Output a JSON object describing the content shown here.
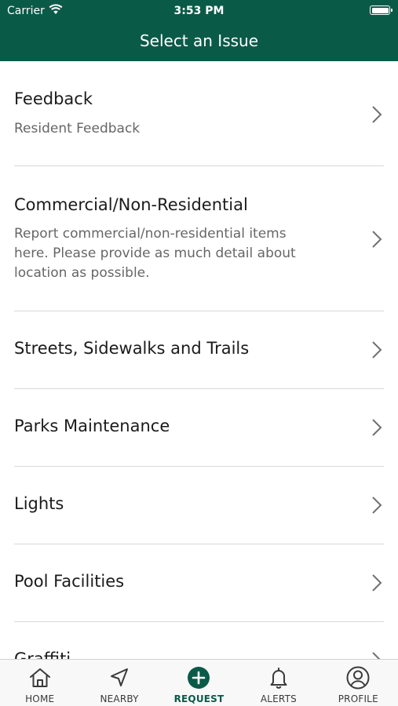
{
  "status": {
    "carrier": "Carrier",
    "time": "3:53 PM"
  },
  "nav": {
    "title": "Select an Issue"
  },
  "issues": [
    {
      "title": "Feedback",
      "subtitle": "Resident Feedback"
    },
    {
      "title": "Commercial/Non-Residential",
      "subtitle": "Report commercial/non-residential items here. Please provide as much detail about location as possible."
    },
    {
      "title": "Streets, Sidewalks and Trails"
    },
    {
      "title": "Parks Maintenance"
    },
    {
      "title": "Lights"
    },
    {
      "title": "Pool Facilities"
    },
    {
      "title": "Graffiti"
    }
  ],
  "tabs": [
    {
      "label": "HOME",
      "icon": "home-icon"
    },
    {
      "label": "NEARBY",
      "icon": "location-arrow-icon"
    },
    {
      "label": "REQUEST",
      "icon": "plus-circle-icon",
      "active": true
    },
    {
      "label": "ALERTS",
      "icon": "bell-icon"
    },
    {
      "label": "PROFILE",
      "icon": "profile-icon"
    }
  ],
  "colors": {
    "brand": "#0a5a48",
    "text": "#1b1b1b",
    "subtext": "#666666",
    "divider": "#d8d8d8",
    "icon": "#3a3a3a"
  }
}
